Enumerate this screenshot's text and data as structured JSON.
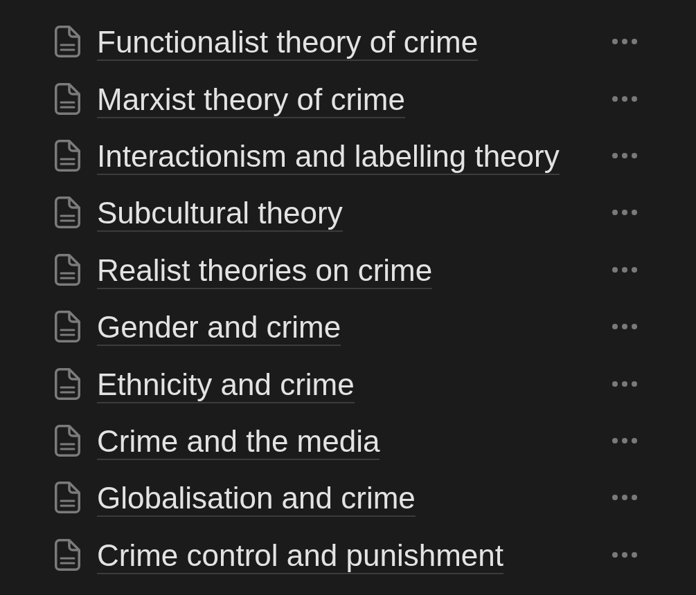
{
  "pages": [
    {
      "title": "Functionalist theory of crime"
    },
    {
      "title": "Marxist theory of crime"
    },
    {
      "title": "Interactionism and labelling theory"
    },
    {
      "title": "Subcultural theory"
    },
    {
      "title": "Realist theories on crime"
    },
    {
      "title": "Gender and crime"
    },
    {
      "title": "Ethnicity and crime"
    },
    {
      "title": "Crime and the media"
    },
    {
      "title": "Globalisation and crime"
    },
    {
      "title": "Crime control and punishment"
    }
  ]
}
